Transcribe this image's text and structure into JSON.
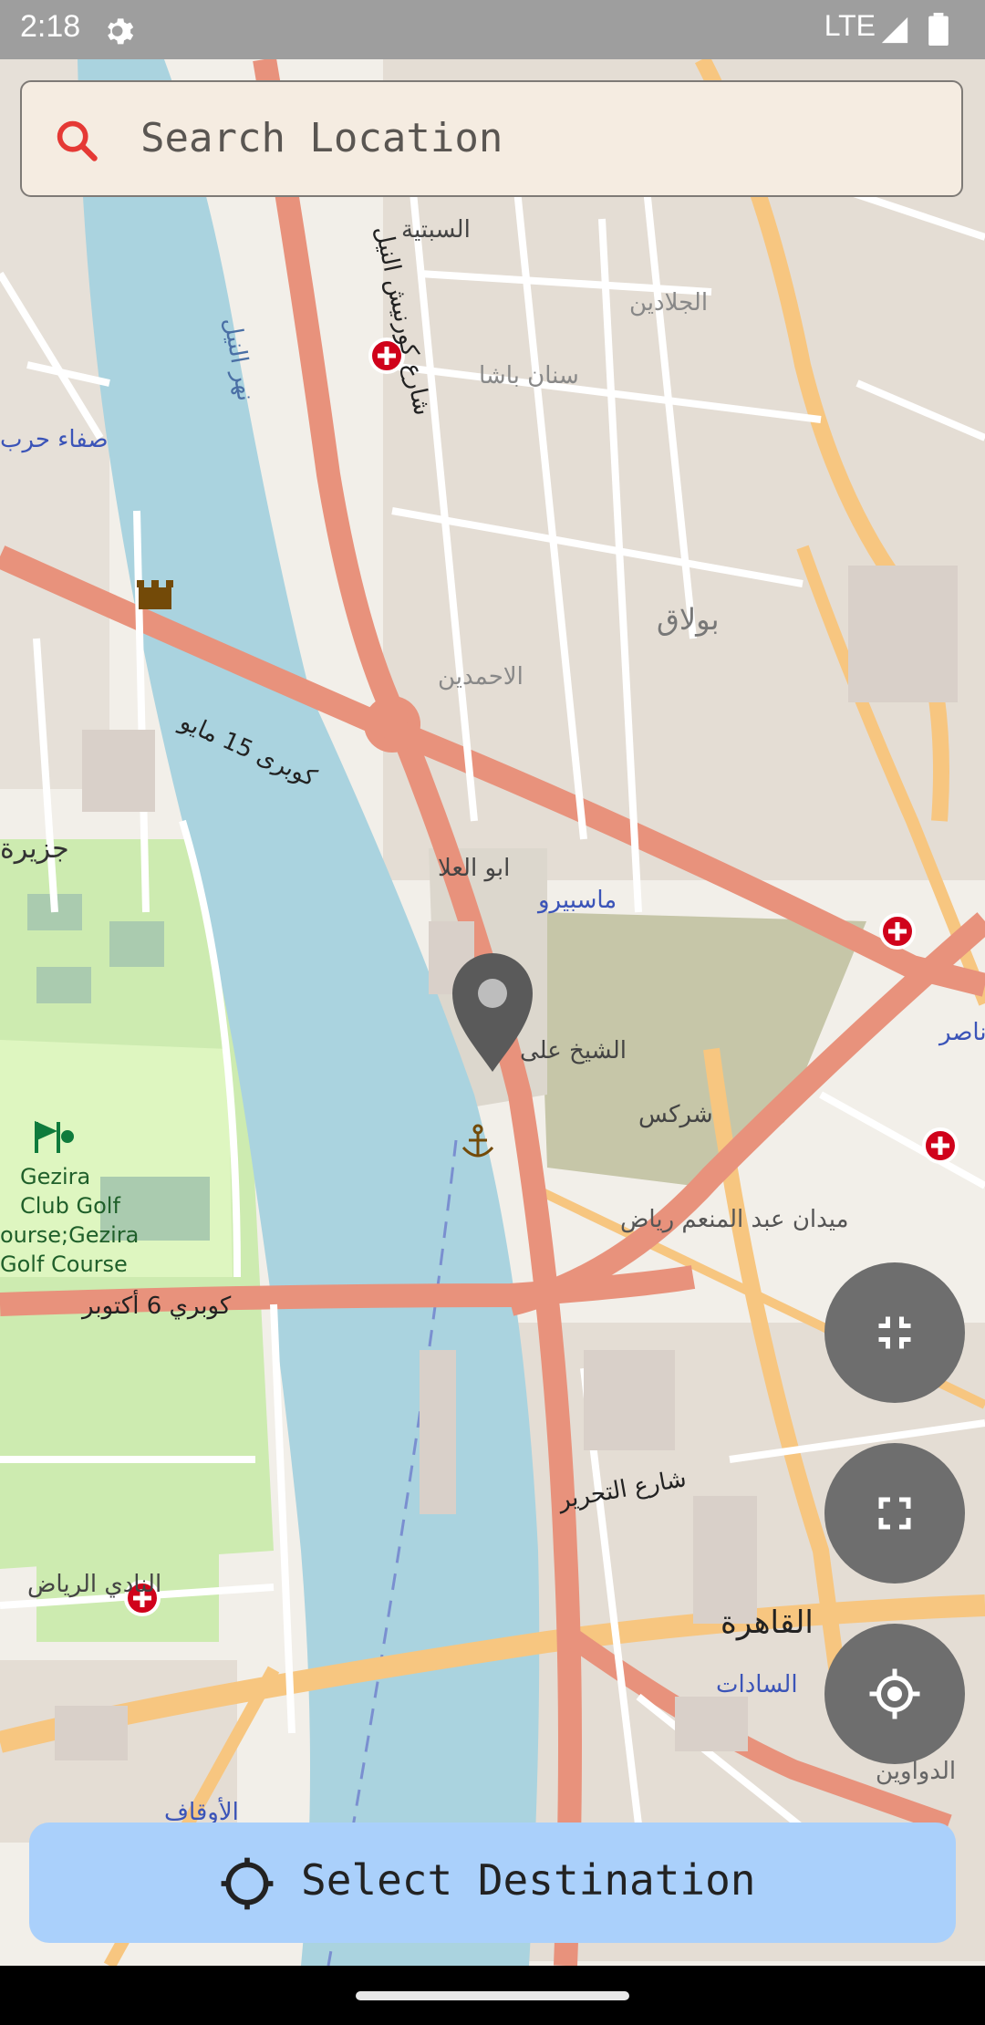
{
  "status_bar": {
    "time": "2:18",
    "network": "LTE",
    "settings_icon": "gear-icon",
    "signal_icon": "signal-icon",
    "battery_icon": "battery-icon"
  },
  "search": {
    "placeholder": "Search Location",
    "icon": "search-icon",
    "icon_color": "#e53935"
  },
  "map": {
    "labels": {
      "gezira_club": [
        "Gezira",
        "Club Golf",
        "ourse;Gezira",
        "Golf Course"
      ],
      "maspero": "ماسبيرو",
      "bulaq": "بولاق",
      "sabtiyya": "السبتية",
      "cairo": "القاهرة",
      "sadat": "السادات",
      "sheikh_ali": "الشيخ على",
      "abu_el_ela": "ابو العلا",
      "nile": "نهر النيل",
      "kobri_6_october": "كوبري 6 أكتوبر",
      "kobri_15_mayo": "كوبرى 15 مايو",
      "corniche": "شارع كورنيش النيل",
      "tahrir_st": "شارع التحرير",
      "midan_abdel_moneim_riad": "ميدان عبد المنعم رياض",
      "sherkes": "شركس",
      "gezira": "جزيرة",
      "tahrir_club": "النادي الرياض",
      "ahmadeen": "الاحمدين",
      "sinan_pasha": "سنان باشا",
      "jaladin": "الجلادين",
      "safa": "صفاء حرب",
      "aouqaf": "الأوقاف",
      "dawawin": "الدواوين",
      "nasser": "ناصر"
    },
    "colors": {
      "water": "#aad3df",
      "land": "#f2efe9",
      "major_road": "#e8927c",
      "secondary_road": "#f7c680",
      "park": "#cdebb0",
      "golf": "#def6c0",
      "building": "#d9d0c9",
      "cemetery": "#aacbaf"
    },
    "marker_icon": "map-pin-icon"
  },
  "fabs": {
    "collapse_icon": "collapse-icon",
    "expand_icon": "expand-icon",
    "location_icon": "my-location-icon",
    "color": "#6e6e6e"
  },
  "destination": {
    "label": "Select Destination",
    "icon": "target-icon",
    "color": "#aad0fb"
  }
}
